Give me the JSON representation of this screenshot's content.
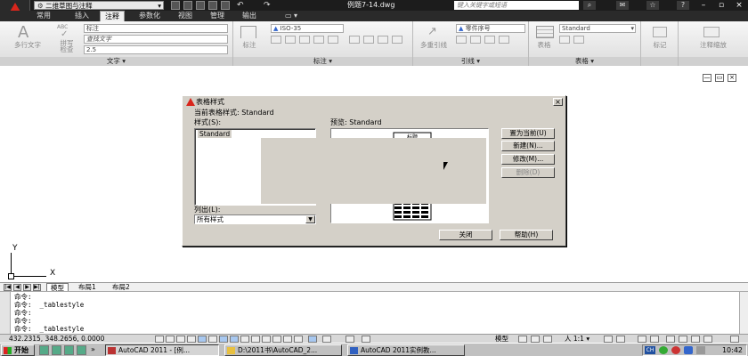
{
  "titlebar": {
    "workspace": "二维草图与注释",
    "doc_title": "例题7-14.dwg",
    "search_placeholder": "键入关键字或短语",
    "qa_undo": "↶",
    "qa_redo": "↷",
    "help_glyph": "?"
  },
  "tabs": [
    "常用",
    "插入",
    "注释",
    "参数化",
    "视图",
    "管理",
    "输出",
    "▭ ▾"
  ],
  "ribbon": {
    "text_panel": {
      "mtext_label": "多行文字",
      "spell_label": "拼写\n检查",
      "style_combo": "标注",
      "find_combo": "查找文字",
      "height_combo": "2.5",
      "title": "文字 ▾",
      "abc": "ABC"
    },
    "dim_panel": {
      "dim_label": "标注",
      "style_combo": "ISO-35",
      "title": "标注 ▾"
    },
    "leader_panel": {
      "multileader_label": "多重引线",
      "style_combo": "零件序号",
      "title": "引线 ▾"
    },
    "table_panel": {
      "table_label": "表格",
      "style_combo": "Standard",
      "title": "表格 ▾"
    },
    "mark_panel": {
      "label": "标记"
    },
    "scale_panel": {
      "label": "注释缩放"
    }
  },
  "dialog": {
    "title": "表格样式",
    "current_style": "当前表格样式: Standard",
    "styles_label": "样式(S):",
    "style_item": "Standard",
    "preview_label": "预览: Standard",
    "preview_header": "标题",
    "list_label": "列出(L):",
    "list_value": "所有样式",
    "buttons": {
      "set_current": "置为当前(U)",
      "new": "新建(N)...",
      "modify": "修改(M)...",
      "delete": "删除(D)",
      "close": "关闭",
      "help": "帮助(H)"
    },
    "close_glyph": "×"
  },
  "canvas": {
    "ucs_x": "X",
    "ucs_y": "Y",
    "vp_buttons": [
      "—",
      "▭",
      "×"
    ]
  },
  "layout_tabs": {
    "model": "模型",
    "layout1": "布局1",
    "layout2": "布局2"
  },
  "command_lines": [
    "命令:",
    "命令:  _tablestyle",
    "命令:",
    "命令:",
    "命令:  _tablestyle"
  ],
  "status": {
    "coords": "432.2315,  348.2656,  0.0000",
    "model": "模型",
    "scale": "人 1:1 ▾"
  },
  "taskbar": {
    "start": "开始",
    "tasks": [
      "AutoCAD 2011 - [例...",
      "D:\\2011书\\AutoCAD_2...",
      "AutoCAD 2011实例教..."
    ],
    "clock": "10:42",
    "tray_badge": "CH"
  }
}
